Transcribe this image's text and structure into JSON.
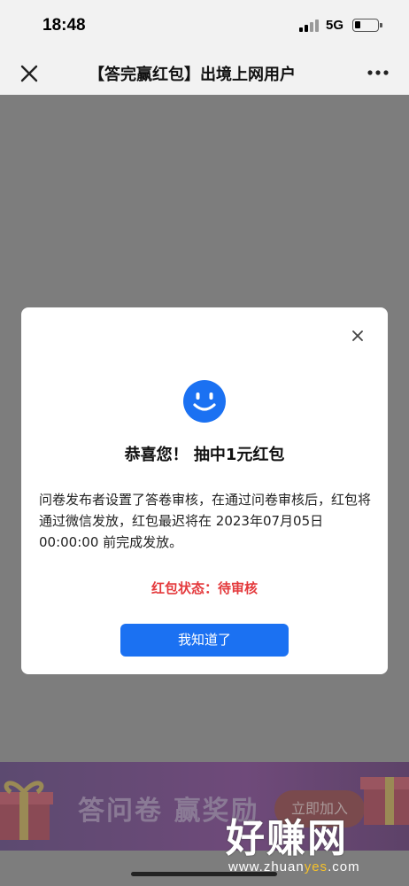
{
  "status_bar": {
    "time": "18:48",
    "network": "5G"
  },
  "nav": {
    "title": "【答完赢红包】出境上网用户"
  },
  "modal": {
    "title": "恭喜您！ 抽中1元红包",
    "body": "问卷发布者设置了答卷审核，在通过问卷审核后，红包将通过微信发放，红包最迟将在 2023年07月05日 00:00:00 前完成发放。",
    "status_label": "红包状态：",
    "status_value": "待审核",
    "ok_label": "我知道了"
  },
  "banner": {
    "title": "答问卷  赢奖励",
    "button_label": "立即加入"
  },
  "watermark": {
    "text": "好赚网",
    "url_prefix": "www.zhuan",
    "url_highlight": "yes",
    "url_suffix": ".com"
  },
  "colors": {
    "accent_blue": "#1b71f2",
    "status_red": "#e4393c",
    "overlay": "#7d7d7d"
  }
}
